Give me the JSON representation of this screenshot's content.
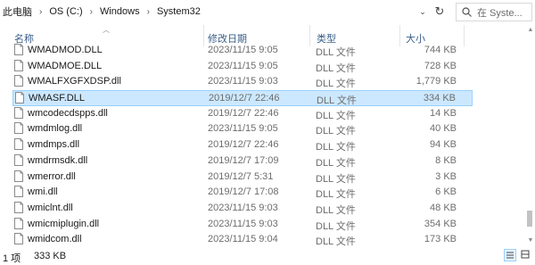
{
  "address": {
    "crumbs": [
      "此电脑",
      "OS (C:)",
      "Windows",
      "System32"
    ],
    "search_placeholder": "在 Syste..."
  },
  "columns": {
    "name": "名称",
    "date": "修改日期",
    "type": "类型",
    "size": "大小"
  },
  "files": [
    {
      "name": "WMADMOD.DLL",
      "date": "2023/11/15 9:05",
      "type": "DLL 文件",
      "size": "744 KB"
    },
    {
      "name": "WMADMOE.DLL",
      "date": "2023/11/15 9:05",
      "type": "DLL 文件",
      "size": "728 KB"
    },
    {
      "name": "WMALFXGFXDSP.dll",
      "date": "2023/11/15 9:03",
      "type": "DLL 文件",
      "size": "1,779 KB"
    },
    {
      "name": "WMASF.DLL",
      "date": "2019/12/7 22:46",
      "type": "DLL 文件",
      "size": "334 KB",
      "selected": true
    },
    {
      "name": "wmcodecdspps.dll",
      "date": "2019/12/7 22:46",
      "type": "DLL 文件",
      "size": "14 KB"
    },
    {
      "name": "wmdmlog.dll",
      "date": "2023/11/15 9:05",
      "type": "DLL 文件",
      "size": "40 KB"
    },
    {
      "name": "wmdmps.dll",
      "date": "2019/12/7 22:46",
      "type": "DLL 文件",
      "size": "94 KB"
    },
    {
      "name": "wmdrmsdk.dll",
      "date": "2019/12/7 17:09",
      "type": "DLL 文件",
      "size": "8 KB"
    },
    {
      "name": "wmerror.dll",
      "date": "2019/12/7 5:31",
      "type": "DLL 文件",
      "size": "3 KB"
    },
    {
      "name": "wmi.dll",
      "date": "2019/12/7 17:08",
      "type": "DLL 文件",
      "size": "6 KB"
    },
    {
      "name": "wmiclnt.dll",
      "date": "2023/11/15 9:03",
      "type": "DLL 文件",
      "size": "48 KB"
    },
    {
      "name": "wmicmiplugin.dll",
      "date": "2023/11/15 9:03",
      "type": "DLL 文件",
      "size": "354 KB"
    },
    {
      "name": "wmidcom.dll",
      "date": "2023/11/15 9:04",
      "type": "DLL 文件",
      "size": "173 KB"
    }
  ],
  "status": {
    "item_count": "1 项",
    "selected_size": "333 KB"
  },
  "colors": {
    "selection_bg": "#cce8ff",
    "selection_border": "#99d1ff",
    "header_text": "#3a5f8a",
    "secondary_text": "#6d6d6d"
  },
  "icons": {
    "refresh": "refresh-icon",
    "search": "search-icon",
    "file": "dll-file-icon",
    "details_view": "details-view-icon",
    "large_icons_view": "large-icons-view-icon"
  }
}
